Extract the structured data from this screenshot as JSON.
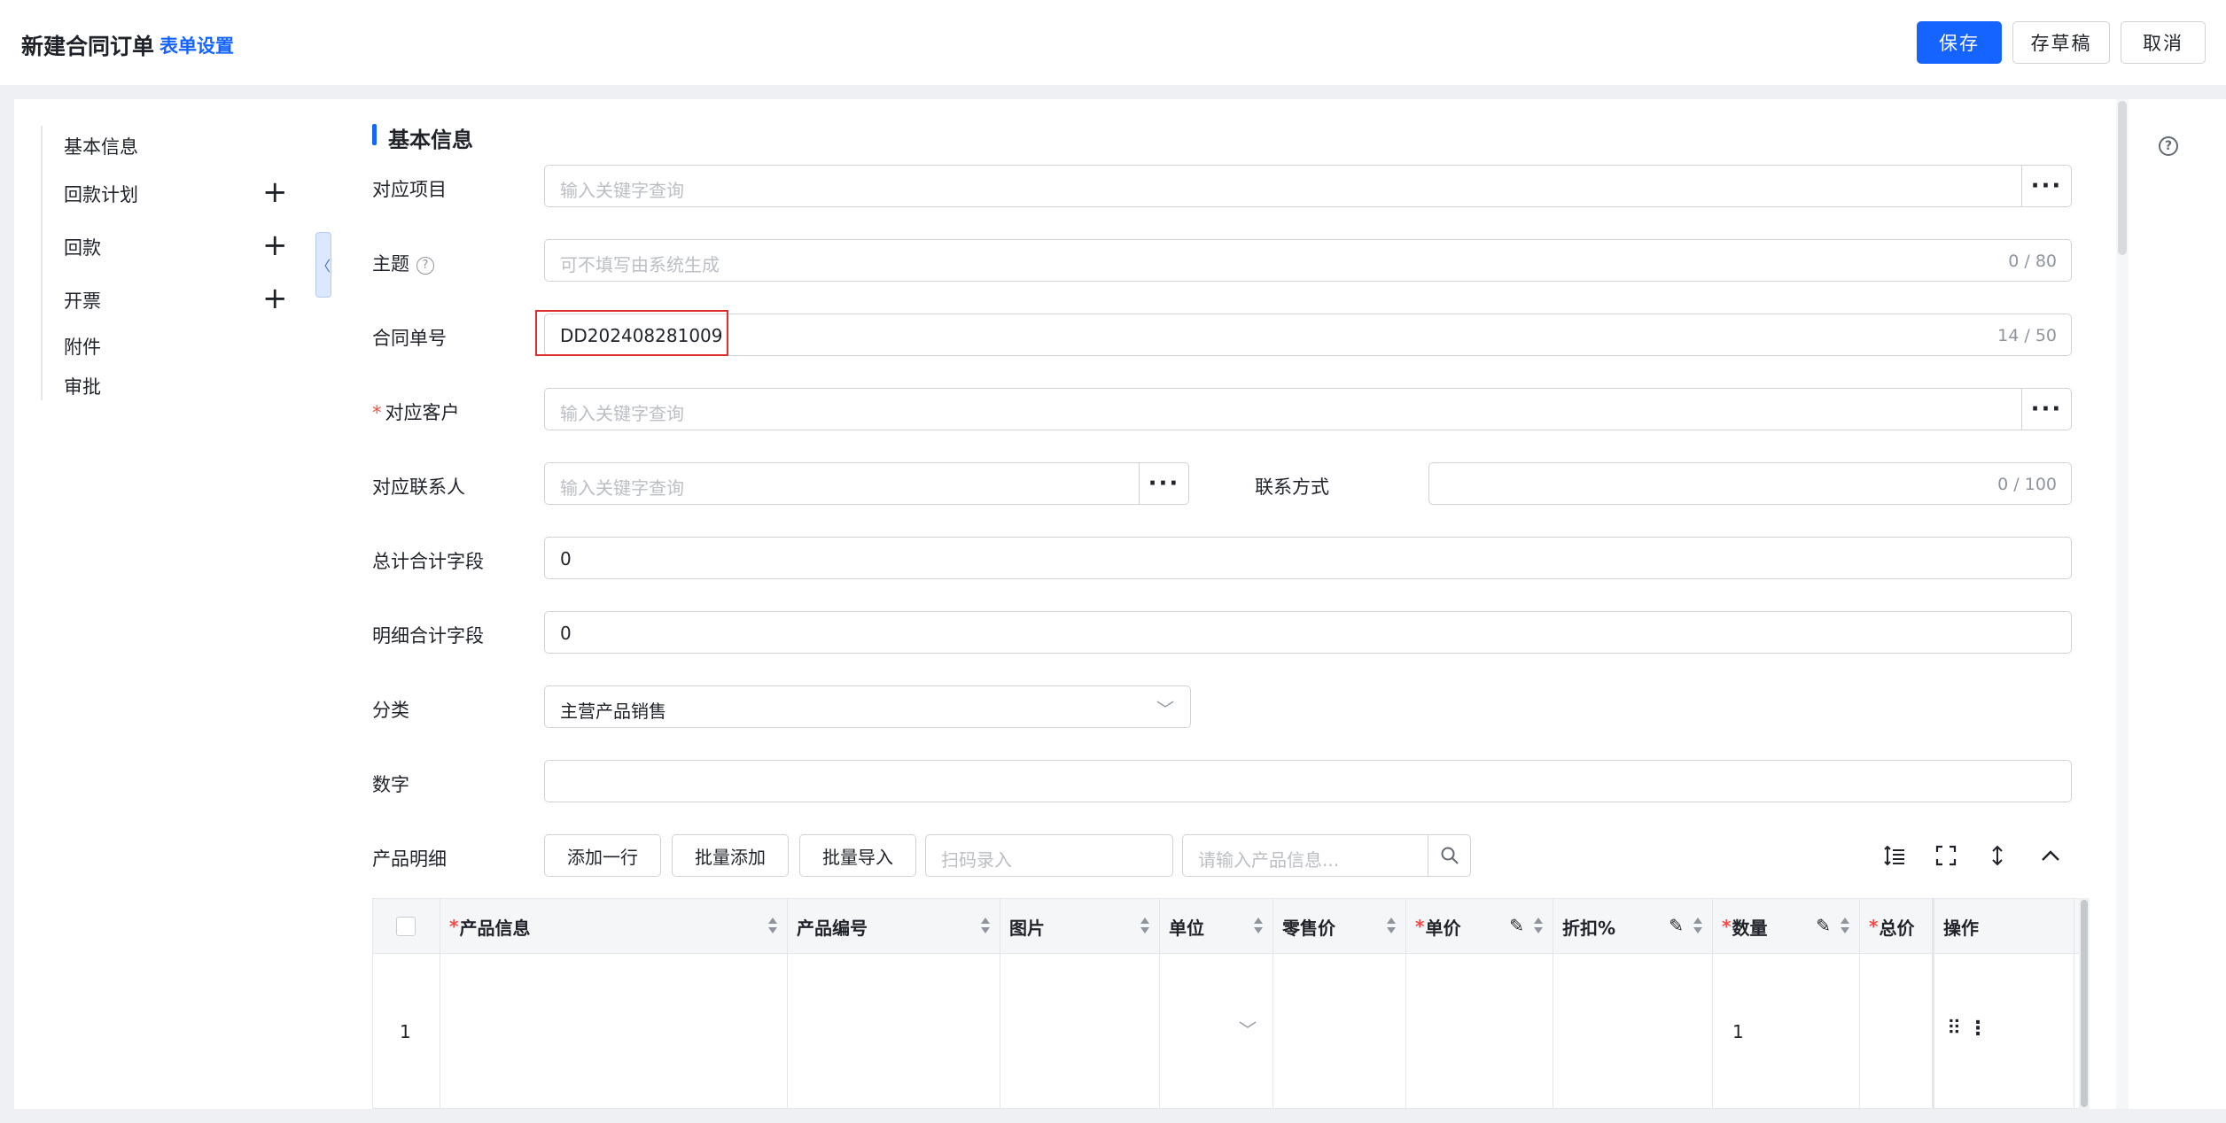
{
  "header": {
    "title": "新建合同订单",
    "form_settings": "表单设置",
    "save": "保存",
    "draft": "存草稿",
    "cancel": "取消"
  },
  "nav": {
    "items": [
      {
        "label": "基本信息",
        "has_add": false
      },
      {
        "label": "回款计划",
        "has_add": true
      },
      {
        "label": "回款",
        "has_add": true
      },
      {
        "label": "开票",
        "has_add": true
      },
      {
        "label": "附件",
        "has_add": false
      },
      {
        "label": "审批",
        "has_add": false
      }
    ],
    "add_glyph": "+",
    "collapse_glyph": "〈"
  },
  "help_glyph": "?",
  "section": {
    "title": "基本信息"
  },
  "form": {
    "project": {
      "label": "对应项目",
      "placeholder": "输入关键字查询",
      "more": "···"
    },
    "subject": {
      "label": "主题",
      "placeholder": "可不填写由系统生成",
      "counter": "0 / 80",
      "help": "?"
    },
    "contract_no": {
      "label": "合同单号",
      "value": "DD202408281009",
      "counter": "14 / 50"
    },
    "customer": {
      "label": "对应客户",
      "required": "*",
      "placeholder": "输入关键字查询",
      "more": "···"
    },
    "contact": {
      "label": "对应联系人",
      "placeholder": "输入关键字查询",
      "more": "···"
    },
    "contact_method": {
      "label": "联系方式",
      "counter": "0 / 100"
    },
    "total_field": {
      "label": "总计合计字段",
      "value": "0"
    },
    "detail_total": {
      "label": "明细合计字段",
      "value": "0"
    },
    "category": {
      "label": "分类",
      "value": "主营产品销售",
      "chevron": "﹀"
    },
    "number": {
      "label": "数字",
      "value": ""
    }
  },
  "products": {
    "label": "产品明细",
    "add_row": "添加一行",
    "batch_add": "批量添加",
    "batch_import": "批量导入",
    "scan_placeholder": "扫码录入",
    "search_placeholder": "请输入产品信息..."
  },
  "table": {
    "columns": [
      {
        "key": "product_info",
        "label": "产品信息",
        "required": "*"
      },
      {
        "key": "product_code",
        "label": "产品编号",
        "required": ""
      },
      {
        "key": "image",
        "label": "图片",
        "required": ""
      },
      {
        "key": "unit",
        "label": "单位",
        "required": ""
      },
      {
        "key": "retail_price",
        "label": "零售价",
        "required": ""
      },
      {
        "key": "unit_price",
        "label": "单价",
        "required": "*"
      },
      {
        "key": "discount",
        "label": "折扣%",
        "required": ""
      },
      {
        "key": "quantity",
        "label": "数量",
        "required": "*"
      },
      {
        "key": "total_price",
        "label": "总价",
        "required": "*"
      },
      {
        "key": "actions",
        "label": "操作",
        "required": ""
      }
    ],
    "rows": [
      {
        "index": "1",
        "quantity": "1",
        "unit_chevron": "﹀",
        "drag": "⠿",
        "more": "⋮"
      }
    ],
    "edit_glyph": "✎"
  }
}
